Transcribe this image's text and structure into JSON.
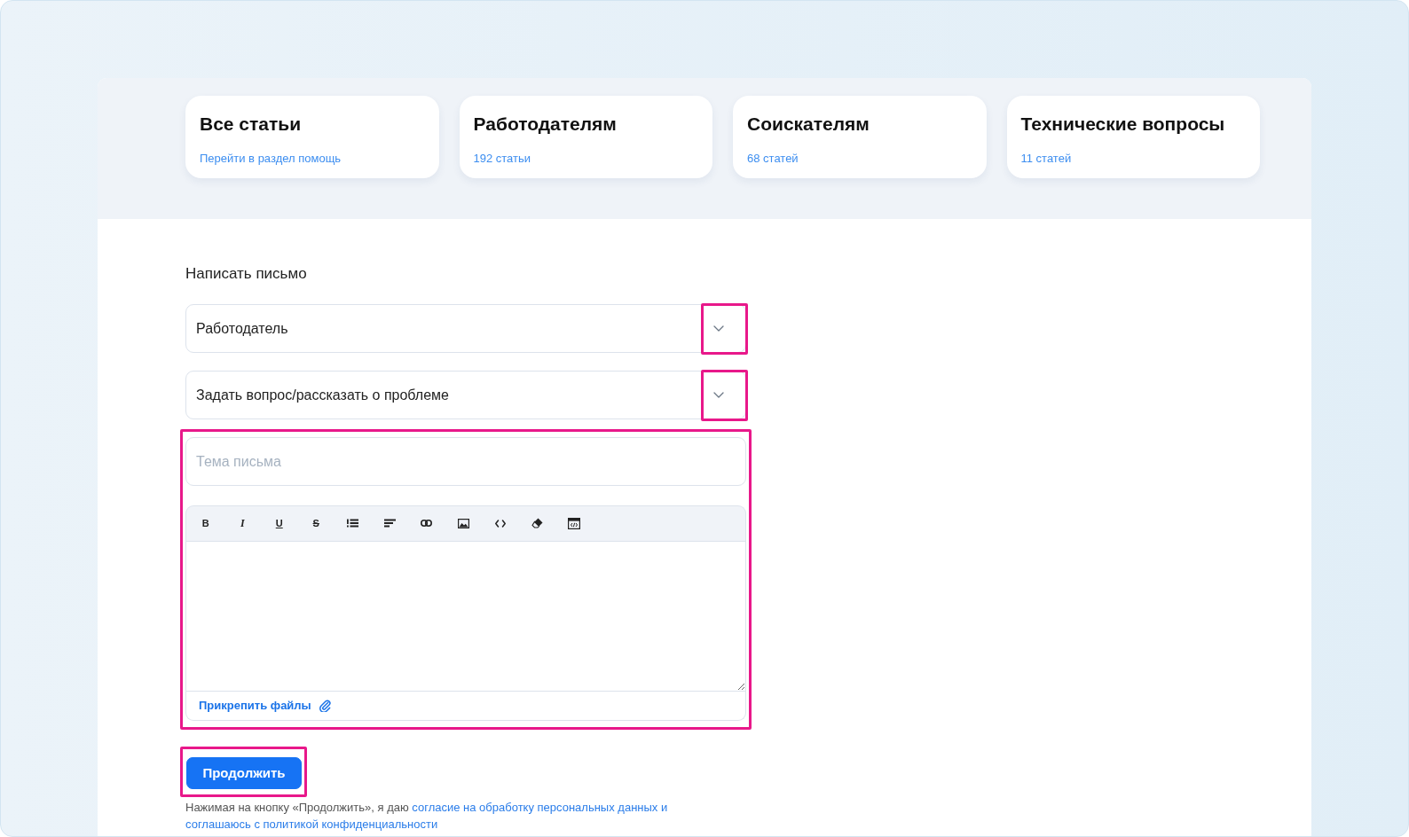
{
  "categories": [
    {
      "title": "Все статьи",
      "subtitle": "Перейти в раздел помощь"
    },
    {
      "title": "Работодателям",
      "subtitle": "192 статьи"
    },
    {
      "title": "Соискателям",
      "subtitle": "68 статей"
    },
    {
      "title": "Технические вопросы",
      "subtitle": "11 статей"
    }
  ],
  "form": {
    "title": "Написать письмо",
    "selects": [
      {
        "value": "Работодатель",
        "highlighted": true
      },
      {
        "value": "Задать вопрос/рассказать о проблеме",
        "highlighted": true
      }
    ],
    "message": {
      "highlighted": true,
      "subject": {
        "placeholder": "Тема письма"
      },
      "toolbar": [
        {
          "kind": "bold",
          "label": "B"
        },
        {
          "kind": "italic",
          "label": "I"
        },
        {
          "kind": "underline",
          "label": "U"
        },
        {
          "kind": "strikethrough",
          "label": "S"
        },
        {
          "kind": "list"
        },
        {
          "kind": "align"
        },
        {
          "kind": "link"
        },
        {
          "kind": "image"
        },
        {
          "kind": "code"
        },
        {
          "kind": "eraser"
        },
        {
          "kind": "source"
        }
      ],
      "attach": "Прикрепить файлы"
    },
    "submit": {
      "label": "Продолжить",
      "highlighted": true
    },
    "consent": {
      "text": "Нажимая на кнопку «Продолжить», я даю",
      "links": [
        "согласие на обработку персональных данных и",
        "соглашаюсь с политикой конфиденциальности"
      ]
    }
  }
}
